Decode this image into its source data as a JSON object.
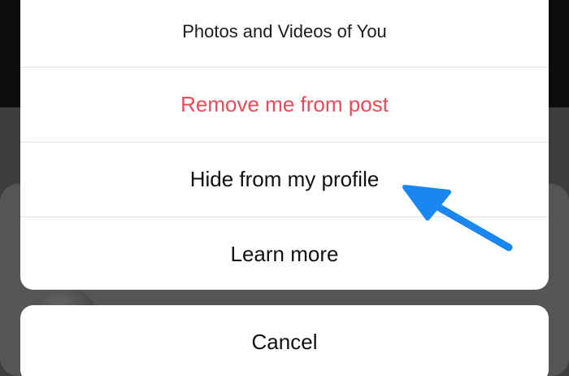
{
  "action_sheet": {
    "title": "Photos and Videos of You",
    "options": [
      {
        "label": "Remove me from post",
        "style": "destructive"
      },
      {
        "label": "Hide from my profile",
        "style": "default"
      },
      {
        "label": "Learn more",
        "style": "default"
      }
    ],
    "cancel_label": "Cancel"
  },
  "annotation": {
    "icon": "arrow-icon",
    "color": "#1a86f0",
    "points_to": "Hide from my profile"
  },
  "colors": {
    "destructive": "#ed4956",
    "sheet_background": "#ffffff",
    "separator": "#e2e2e4"
  }
}
